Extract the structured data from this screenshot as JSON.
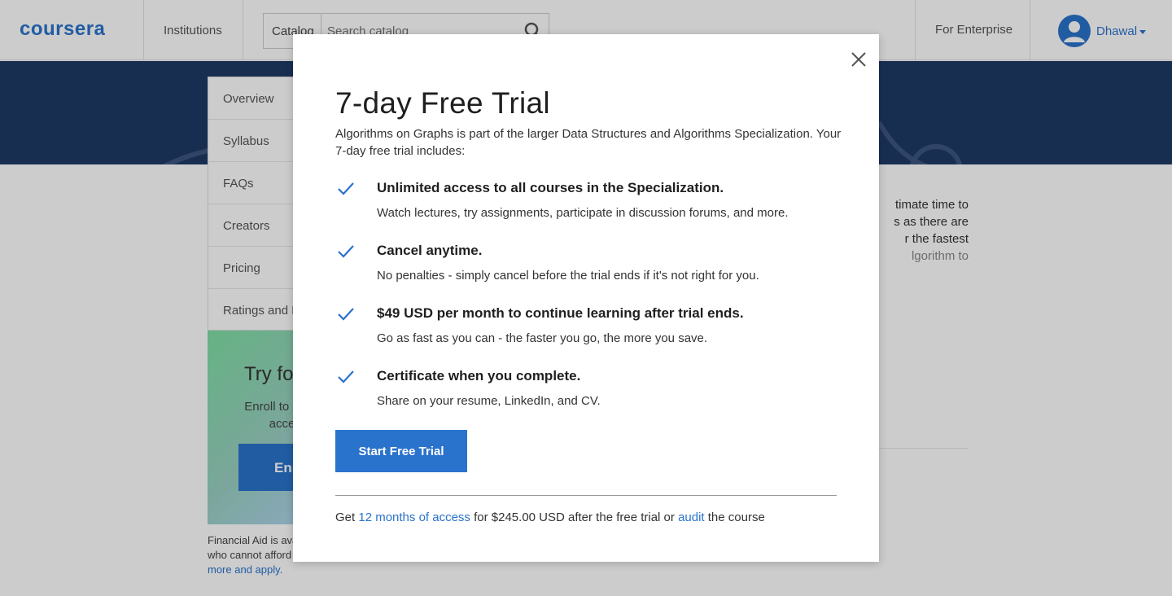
{
  "header": {
    "logo": "coursera",
    "nav_institutions": "Institutions",
    "catalog_label": "Catalog",
    "search_placeholder": "Search catalog",
    "for_enterprise": "For Enterprise",
    "user_name": "Dhawal"
  },
  "sidebar": {
    "items": [
      {
        "label": "Overview"
      },
      {
        "label": "Syllabus"
      },
      {
        "label": "FAQs"
      },
      {
        "label": "Creators"
      },
      {
        "label": "Pricing"
      },
      {
        "label": "Ratings and R"
      }
    ]
  },
  "try_panel": {
    "title": "Try fo",
    "text": "Enroll to star full access",
    "button": "Enr"
  },
  "financial_aid": {
    "text": "Financial Aid is ava who cannot afford",
    "link": "more and apply."
  },
  "description_fragment": {
    "lines": [
      "timate time to",
      "s as there are",
      "r the fastest",
      "lgorithm to"
    ]
  },
  "modal": {
    "title": "7-day Free Trial",
    "intro": "Algorithms on Graphs is part of the larger Data Structures and Algorithms Specialization. Your 7-day free trial includes:",
    "benefits": [
      {
        "title": "Unlimited access to all courses in the Specialization.",
        "desc": "Watch lectures, try assignments, participate in discussion forums, and more."
      },
      {
        "title": "Cancel anytime.",
        "desc": "No penalties - simply cancel before the trial ends if it's not right for you."
      },
      {
        "title": "$49 USD per month to continue learning after trial ends.",
        "desc": "Go as fast as you can - the faster you go, the more you save."
      },
      {
        "title": "Certificate when you complete.",
        "desc": "Share on your resume, LinkedIn, and CV."
      }
    ],
    "start_button": "Start Free Trial",
    "footer": {
      "prefix": "Get ",
      "access_link": "12 months of access",
      "middle": " for $245.00 USD after the free trial or ",
      "audit_link": "audit",
      "suffix": " the course"
    }
  },
  "colors": {
    "brand": "#2a73cc",
    "check": "#2a73cc"
  }
}
